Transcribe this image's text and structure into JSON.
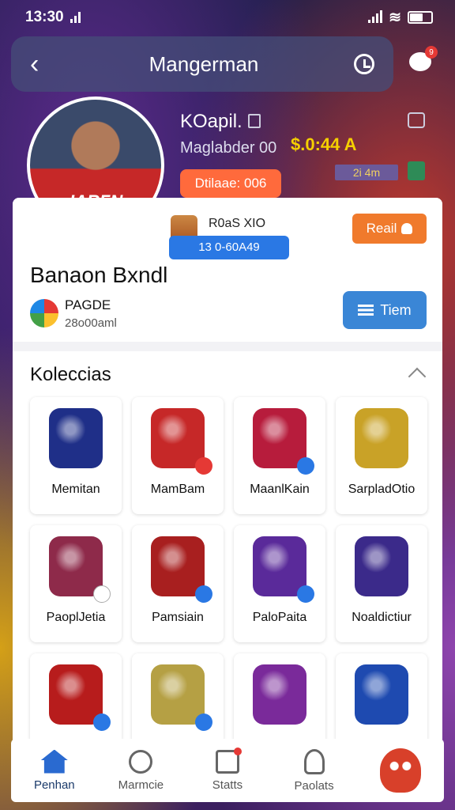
{
  "status_bar": {
    "time": "13:30"
  },
  "header": {
    "title": "Mangerman",
    "notification_count": "9"
  },
  "profile": {
    "user_name": "KOapil.",
    "user_subtitle": "Maglabder 00",
    "balance": "$.0:44 A",
    "level_chip": "2i 4m",
    "orange_pill": "Dtilaae: 006",
    "mini_name": "R0aS XIO",
    "mini_chip": "13 0-60A49",
    "follow_label": "Reail",
    "display_name": "Banaon Bxndl",
    "team_name": "PAGDE",
    "team_sub": "28o00aml",
    "team_button_label": "Tiem"
  },
  "collection": {
    "title": "Koleccias",
    "items": [
      {
        "label": "Memitan",
        "color": "#1f2f88",
        "badge_color": ""
      },
      {
        "label": "MamBam",
        "color": "#c62828",
        "badge_color": "#e53935"
      },
      {
        "label": "MaanlKain",
        "color": "#b71c3c",
        "badge_color": "#2a78e4"
      },
      {
        "label": "SarpladOtio",
        "color": "#c9a227",
        "badge_color": ""
      },
      {
        "label": "PaoplJetia",
        "color": "#8e2a4a",
        "badge_color": "#ffffff"
      },
      {
        "label": "Pamsiain",
        "color": "#a81f1f",
        "badge_color": "#2a78e4"
      },
      {
        "label": "PaloPaita",
        "color": "#5a2a9a",
        "badge_color": "#2a78e4"
      },
      {
        "label": "Noaldictiur",
        "color": "#3b2a8a",
        "badge_color": ""
      },
      {
        "label": "",
        "color": "#b71c1c",
        "badge_color": "#2a78e4"
      },
      {
        "label": "",
        "color": "#b5a044",
        "badge_color": "#2a78e4"
      },
      {
        "label": "",
        "color": "#7a2a9a",
        "badge_color": ""
      },
      {
        "label": "",
        "color": "#1e4ab0",
        "badge_color": ""
      }
    ]
  },
  "bottom_nav": [
    {
      "label": "Penhan",
      "icon": "home-icon"
    },
    {
      "label": "Marmcie",
      "icon": "search-icon"
    },
    {
      "label": "Statts",
      "icon": "stats-icon"
    },
    {
      "label": "Paolats",
      "icon": "profile-icon"
    },
    {
      "label": "",
      "icon": "mascot-icon"
    }
  ]
}
